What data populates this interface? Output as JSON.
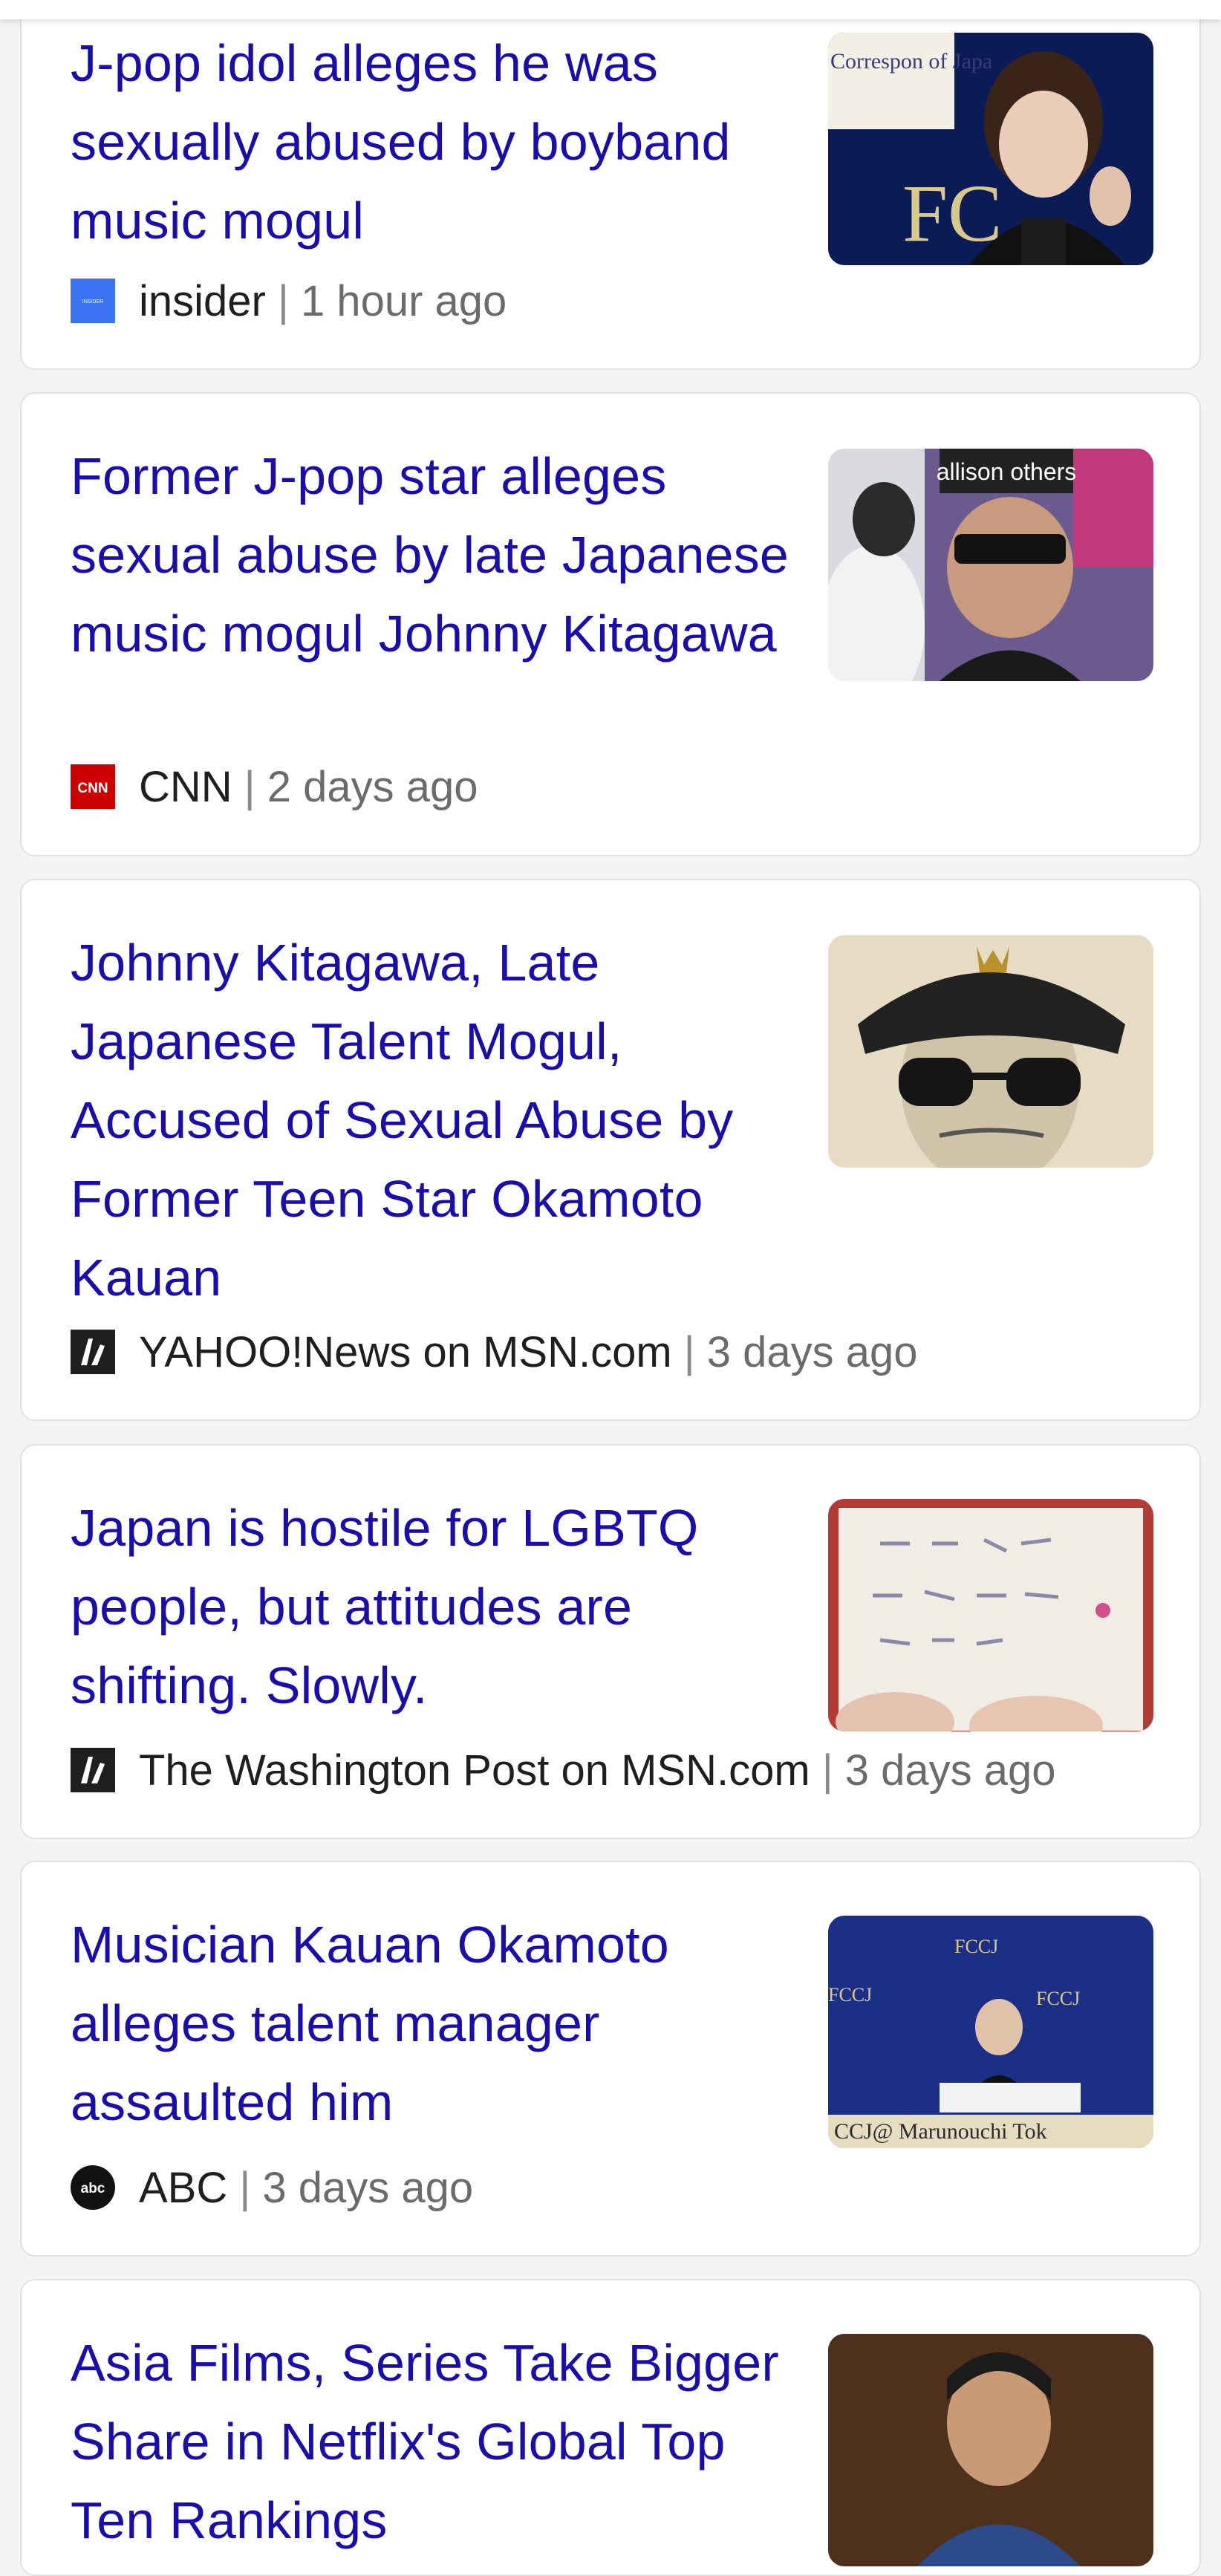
{
  "articles": [
    {
      "headline": "J-pop idol alleges he was sexually abused by boyband music mogul",
      "source": "insider",
      "separator": "|",
      "time": "1 hour ago",
      "source_icon": "insider-logo-icon",
      "thumbnail": "press-conference-photo"
    },
    {
      "headline": "Former J-pop star alleges sexual abuse by late Japanese music mogul Johnny Kitagawa",
      "source": "CNN",
      "separator": "|",
      "time": "2 days ago",
      "source_icon": "cnn-logo-icon",
      "thumbnail": "tv-screen-photo"
    },
    {
      "headline": "Johnny Kitagawa, Late Japanese Talent Mogul, Accused of Sexual Abuse by Former Teen Star Okamoto Kauan",
      "source": "YAHOO!News on MSN.com",
      "separator": "|",
      "time": "3 days ago",
      "source_icon": "msn-logo-icon",
      "thumbnail": "illustration-portrait"
    },
    {
      "headline": "Japan is hostile for LGBTQ people, but attitudes are shifting. Slowly.",
      "source": "The Washington Post on MSN.com",
      "separator": "|",
      "time": "3 days ago",
      "source_icon": "msn-logo-icon",
      "thumbnail": "handwritten-sign-photo"
    },
    {
      "headline": "Musician Kauan Okamoto alleges talent manager assaulted him",
      "source": "ABC",
      "separator": "|",
      "time": "3 days ago",
      "source_icon": "abc-logo-icon",
      "thumbnail": "fccj-press-conference-photo"
    },
    {
      "headline": "Asia Films, Series Take Bigger Share in Netflix's Global Top Ten Rankings",
      "source": "",
      "separator": "",
      "time": "",
      "source_icon": "",
      "thumbnail": "film-still-photo"
    }
  ],
  "thumb_text": {
    "t1_backdrop": "The Correspon of Japa",
    "t1_logo": "FC",
    "t2_sign": "allison others",
    "t5_logo": "FCCJ",
    "t5_banner": "CCJ@ Marunouchi Tok"
  },
  "icon_text": {
    "insider": "INSIDER",
    "cnn": "CNN",
    "abc": "abc"
  },
  "colors": {
    "headline": "#1a0dab",
    "source": "#1f1f1f",
    "time": "#6b6b6b",
    "card_border": "#e2e2e6",
    "page_bg": "#f4f4f5"
  }
}
